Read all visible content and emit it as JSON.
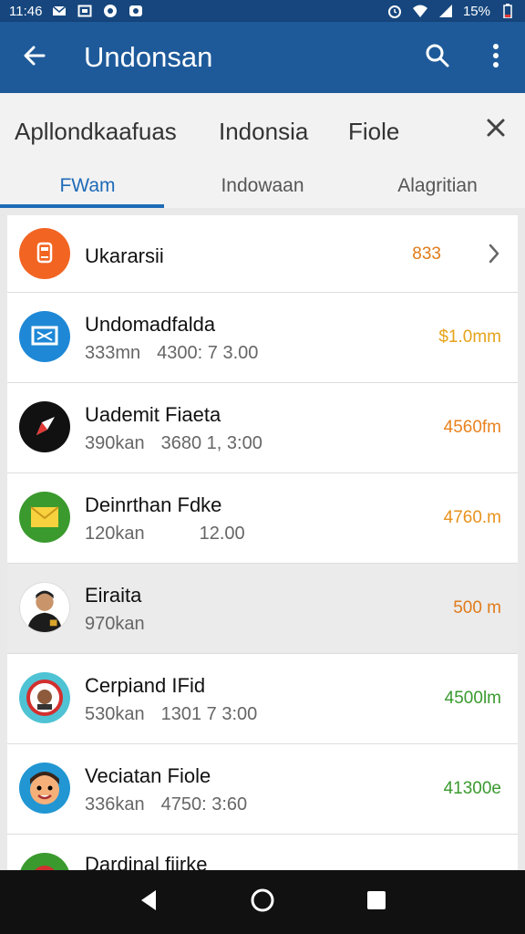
{
  "status_bar": {
    "time": "11:46",
    "battery": "15%",
    "icons": [
      "mail-icon",
      "image-icon",
      "chat-icon",
      "camera-icon",
      "alarm-icon",
      "wifi-icon",
      "signal-icon",
      "battery-icon"
    ]
  },
  "app_bar": {
    "title": "Undonsan",
    "back_icon": "arrow-left-icon",
    "search_icon": "search-icon",
    "menu_icon": "more-vert-icon"
  },
  "filter_chips": {
    "items": [
      "Apllondkaafuas",
      "Indonsia",
      "Fiole"
    ],
    "close_icon": "close-icon"
  },
  "tabs": {
    "items": [
      "FWam",
      "Indowaan",
      "Alagritian"
    ],
    "active_index": 0
  },
  "list": {
    "items": [
      {
        "title": "Ukararsii",
        "subtitle_left": "",
        "subtitle_right": "",
        "value": "833",
        "value_color": "#e07b1a",
        "avatar": "tablet-icon",
        "avatar_bg": "#f26422",
        "chevron": true
      },
      {
        "title": "Undomadfalda",
        "subtitle_left": "333mn",
        "subtitle_right": "4300: 7 3.00",
        "value": "$1.0mm",
        "value_color": "#e6a31a",
        "avatar": "message-icon",
        "avatar_bg": "#1e88d6"
      },
      {
        "title": "Uademit Fiaeta",
        "subtitle_left": "390kan",
        "subtitle_right": "3680 1, 3:00",
        "value": "4560fm",
        "value_color": "#e8821e",
        "avatar": "compass-icon",
        "avatar_bg": "#111111"
      },
      {
        "title": "Deinrthan Fdke",
        "subtitle_left": "120kan",
        "subtitle_right": "12.00",
        "value": "4760.m",
        "value_color": "#e8921e",
        "avatar": "envelope-icon",
        "avatar_bg": "#3a9a2e"
      },
      {
        "title": "Eiraita",
        "subtitle_left": "970kan",
        "subtitle_right": "",
        "value": "500 m",
        "value_color": "#e07b1a",
        "avatar": "person-photo-icon",
        "avatar_bg": "#ffffff"
      },
      {
        "title": "Cerpiand IFid",
        "subtitle_left": "530kan",
        "subtitle_right": "1301 7 3:00",
        "value": "4500lm",
        "value_color": "#3a9a2e",
        "avatar": "face-badge-icon",
        "avatar_bg": "#4fc3d4"
      },
      {
        "title": "Veciatan Fiole",
        "subtitle_left": "336kan",
        "subtitle_right": "4750: 3:60",
        "value": "41300e",
        "value_color": "#3a9a2e",
        "avatar": "cartoon-face-icon",
        "avatar_bg": "#2196d3"
      },
      {
        "title": "Dardinal fiirke",
        "subtitle_left": "",
        "subtitle_right": "",
        "value": "",
        "value_color": "#3a9a2e",
        "avatar": "emblem-icon",
        "avatar_bg": "#3a9a2e"
      }
    ]
  },
  "nav_bar": {
    "back": "nav-back-icon",
    "home": "nav-home-icon",
    "recents": "nav-recents-icon"
  }
}
